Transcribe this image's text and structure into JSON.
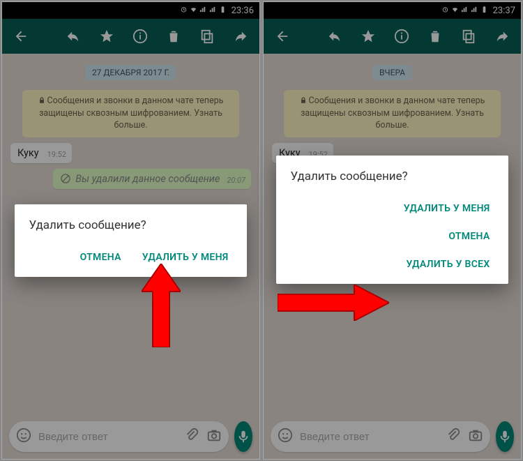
{
  "left": {
    "status": {
      "time": "23:36"
    },
    "date_chip": "27 ДЕКАБРЯ 2017 Г.",
    "system_msg": "Сообщения и звонки в данном чате теперь защищены сквозным шифрованием. Узнать больше.",
    "msg1": {
      "text": "Куку",
      "time": "19:52"
    },
    "deleted": {
      "text": "Вы удалили данное сообщение",
      "time": "20:07"
    },
    "input_placeholder": "Введите ответ",
    "dialog": {
      "title": "Удалить сообщение?",
      "cancel": "ОТМЕНА",
      "delete_me": "УДАЛИТЬ У МЕНЯ"
    }
  },
  "right": {
    "status": {
      "time": "23:37"
    },
    "date_chip": "ВЧЕРА",
    "system_msg": "Сообщения и звонки в данном чате теперь защищены сквозным шифрованием. Узнать больше.",
    "msg1": {
      "text": "Куку",
      "time": "19:52"
    },
    "input_placeholder": "Введите ответ",
    "dialog": {
      "title": "Удалить сообщение?",
      "delete_me": "УДАЛИТЬ У МЕНЯ",
      "cancel": "ОТМЕНА",
      "delete_all": "УДАЛИТЬ У ВСЕХ"
    }
  }
}
